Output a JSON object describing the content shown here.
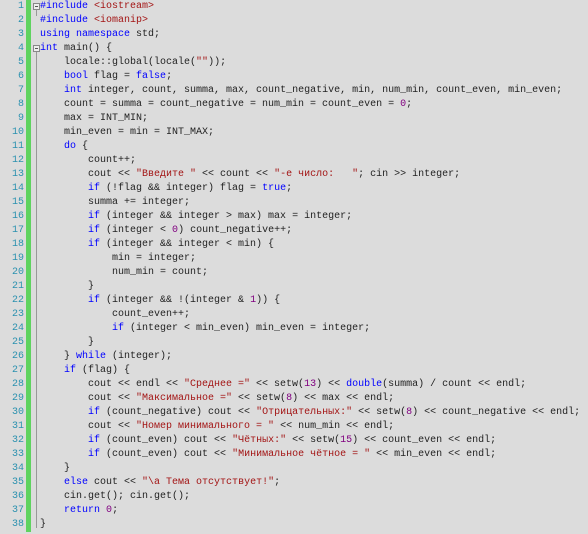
{
  "colors": {
    "keyword": "#0000ff",
    "string": "#a31515",
    "number": "#800080",
    "line_number": "#2b91af",
    "change_bar": "#5fd35f",
    "background": "#dcdcdc"
  },
  "fold_lines": [
    1,
    4
  ],
  "lines": [
    {
      "i": 0,
      "t": [
        [
          "k",
          "#include"
        ],
        [
          "p",
          " "
        ],
        [
          "s",
          "<iostream>"
        ]
      ]
    },
    {
      "i": 0,
      "t": [
        [
          "k",
          "#include"
        ],
        [
          "p",
          " "
        ],
        [
          "s",
          "<iomanip>"
        ]
      ]
    },
    {
      "i": 0,
      "t": [
        [
          "k",
          "using"
        ],
        [
          "p",
          " "
        ],
        [
          "k",
          "namespace"
        ],
        [
          "p",
          " std;"
        ]
      ]
    },
    {
      "i": 0,
      "t": [
        [
          "k",
          "int"
        ],
        [
          "p",
          " main() {"
        ]
      ]
    },
    {
      "i": 1,
      "t": [
        [
          "p",
          "locale::global(locale("
        ],
        [
          "s",
          "\"\""
        ],
        [
          "p",
          "));"
        ]
      ]
    },
    {
      "i": 1,
      "t": [
        [
          "k",
          "bool"
        ],
        [
          "p",
          " flag = "
        ],
        [
          "k",
          "false"
        ],
        [
          "p",
          ";"
        ]
      ]
    },
    {
      "i": 1,
      "t": [
        [
          "k",
          "int"
        ],
        [
          "p",
          " integer, count, summa, max, count_negative, min, num_min, count_even, min_even;"
        ]
      ]
    },
    {
      "i": 1,
      "t": [
        [
          "p",
          "count = summa = count_negative = num_min = count_even = "
        ],
        [
          "n",
          "0"
        ],
        [
          "p",
          ";"
        ]
      ]
    },
    {
      "i": 1,
      "t": [
        [
          "p",
          "max = INT_MIN;"
        ]
      ]
    },
    {
      "i": 1,
      "t": [
        [
          "p",
          "min_even = min = INT_MAX;"
        ]
      ]
    },
    {
      "i": 1,
      "t": [
        [
          "k",
          "do"
        ],
        [
          "p",
          " {"
        ]
      ]
    },
    {
      "i": 2,
      "t": [
        [
          "p",
          "count++;"
        ]
      ]
    },
    {
      "i": 2,
      "t": [
        [
          "p",
          "cout << "
        ],
        [
          "s",
          "\"Введите \""
        ],
        [
          "p",
          " << count << "
        ],
        [
          "s",
          "\"-е число:   \""
        ],
        [
          "p",
          "; cin >> integer;"
        ]
      ]
    },
    {
      "i": 2,
      "t": [
        [
          "k",
          "if"
        ],
        [
          "p",
          " (!flag && integer) flag = "
        ],
        [
          "k",
          "true"
        ],
        [
          "p",
          ";"
        ]
      ]
    },
    {
      "i": 2,
      "t": [
        [
          "p",
          "summa += integer;"
        ]
      ]
    },
    {
      "i": 2,
      "t": [
        [
          "k",
          "if"
        ],
        [
          "p",
          " (integer && integer > max) max = integer;"
        ]
      ]
    },
    {
      "i": 2,
      "t": [
        [
          "k",
          "if"
        ],
        [
          "p",
          " (integer < "
        ],
        [
          "n",
          "0"
        ],
        [
          "p",
          ") count_negative++;"
        ]
      ]
    },
    {
      "i": 2,
      "t": [
        [
          "k",
          "if"
        ],
        [
          "p",
          " (integer && integer < min) {"
        ]
      ]
    },
    {
      "i": 3,
      "t": [
        [
          "p",
          "min = integer;"
        ]
      ]
    },
    {
      "i": 3,
      "t": [
        [
          "p",
          "num_min = count;"
        ]
      ]
    },
    {
      "i": 2,
      "t": [
        [
          "p",
          "}"
        ]
      ]
    },
    {
      "i": 2,
      "t": [
        [
          "k",
          "if"
        ],
        [
          "p",
          " (integer && !(integer & "
        ],
        [
          "n",
          "1"
        ],
        [
          "p",
          ")) {"
        ]
      ]
    },
    {
      "i": 3,
      "t": [
        [
          "p",
          "count_even++;"
        ]
      ]
    },
    {
      "i": 3,
      "t": [
        [
          "k",
          "if"
        ],
        [
          "p",
          " (integer < min_even) min_even = integer;"
        ]
      ]
    },
    {
      "i": 2,
      "t": [
        [
          "p",
          "}"
        ]
      ]
    },
    {
      "i": 1,
      "t": [
        [
          "p",
          "} "
        ],
        [
          "k",
          "while"
        ],
        [
          "p",
          " (integer);"
        ]
      ]
    },
    {
      "i": 1,
      "t": [
        [
          "k",
          "if"
        ],
        [
          "p",
          " (flag) {"
        ]
      ]
    },
    {
      "i": 2,
      "t": [
        [
          "p",
          "cout << endl << "
        ],
        [
          "s",
          "\"Среднее =\""
        ],
        [
          "p",
          " << setw("
        ],
        [
          "n",
          "13"
        ],
        [
          "p",
          ") << "
        ],
        [
          "k",
          "double"
        ],
        [
          "p",
          "(summa) / count << endl;"
        ]
      ]
    },
    {
      "i": 2,
      "t": [
        [
          "p",
          "cout << "
        ],
        [
          "s",
          "\"Максимальное =\""
        ],
        [
          "p",
          " << setw("
        ],
        [
          "n",
          "8"
        ],
        [
          "p",
          ") << max << endl;"
        ]
      ]
    },
    {
      "i": 2,
      "t": [
        [
          "k",
          "if"
        ],
        [
          "p",
          " (count_negative) cout << "
        ],
        [
          "s",
          "\"Отрицательных:\""
        ],
        [
          "p",
          " << setw("
        ],
        [
          "n",
          "8"
        ],
        [
          "p",
          ") << count_negative << endl;"
        ]
      ]
    },
    {
      "i": 2,
      "t": [
        [
          "p",
          "cout << "
        ],
        [
          "s",
          "\"Номер минимального = \""
        ],
        [
          "p",
          " << num_min << endl;"
        ]
      ]
    },
    {
      "i": 2,
      "t": [
        [
          "k",
          "if"
        ],
        [
          "p",
          " (count_even) cout << "
        ],
        [
          "s",
          "\"Чётных:\""
        ],
        [
          "p",
          " << setw("
        ],
        [
          "n",
          "15"
        ],
        [
          "p",
          ") << count_even << endl;"
        ]
      ]
    },
    {
      "i": 2,
      "t": [
        [
          "k",
          "if"
        ],
        [
          "p",
          " (count_even) cout << "
        ],
        [
          "s",
          "\"Минимальное чётное = \""
        ],
        [
          "p",
          " << min_even << endl;"
        ]
      ]
    },
    {
      "i": 1,
      "t": [
        [
          "p",
          "}"
        ]
      ]
    },
    {
      "i": 1,
      "t": [
        [
          "k",
          "else"
        ],
        [
          "p",
          " cout << "
        ],
        [
          "s",
          "\"\\a Тема отсутствует!\""
        ],
        [
          "p",
          ";"
        ]
      ]
    },
    {
      "i": 1,
      "t": [
        [
          "p",
          "cin.get(); cin.get();"
        ]
      ]
    },
    {
      "i": 1,
      "t": [
        [
          "k",
          "return"
        ],
        [
          "p",
          " "
        ],
        [
          "n",
          "0"
        ],
        [
          "p",
          ";"
        ]
      ]
    },
    {
      "i": 0,
      "t": [
        [
          "p",
          "}"
        ]
      ]
    }
  ]
}
